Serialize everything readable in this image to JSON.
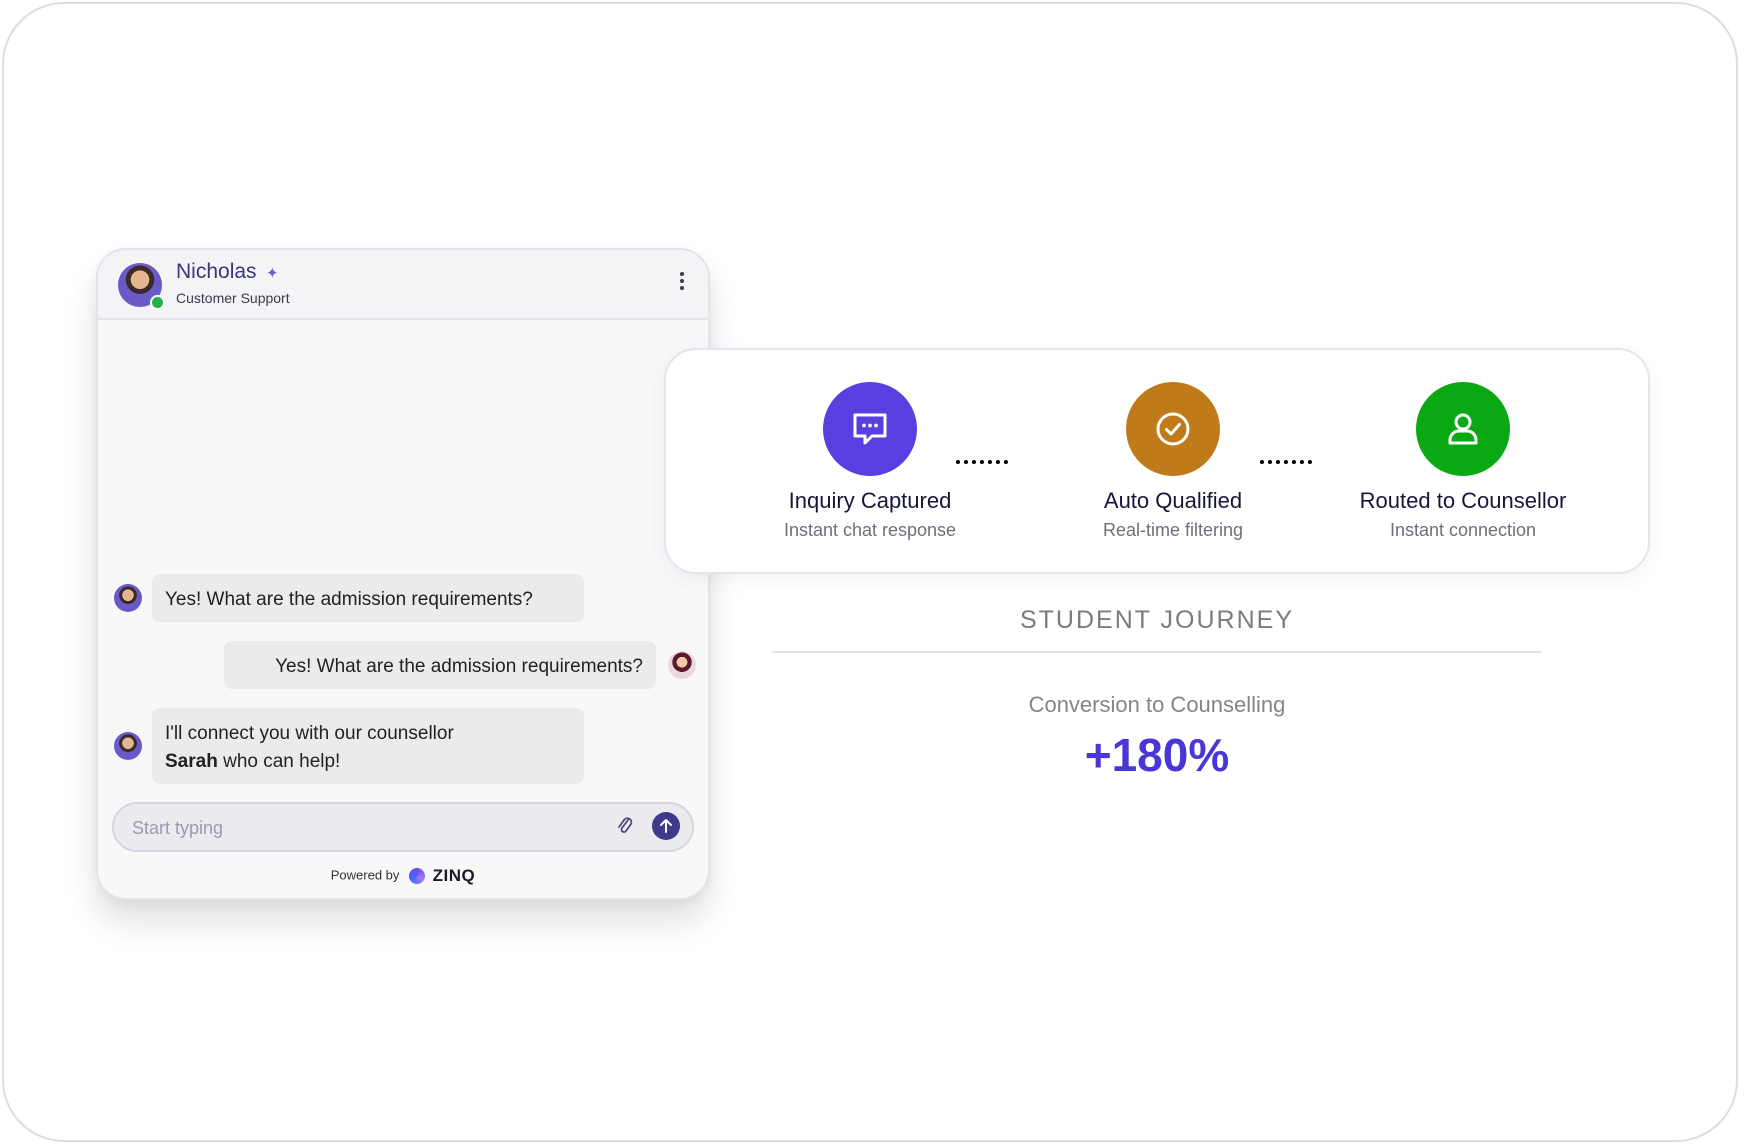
{
  "chat": {
    "agent_name": "Nicholas",
    "agent_role": "Customer Support",
    "messages": [
      {
        "from": "agent",
        "text": "Yes! What are the admission requirements?"
      },
      {
        "from": "user",
        "text": "Yes! What are the admission requirements?"
      },
      {
        "from": "agent",
        "text_before": "I'll connect you with our counsellor",
        "bold": "Sarah",
        "text_after": " who can help!"
      }
    ],
    "composer_placeholder": "Start typing",
    "powered_by": "Powered by",
    "brand": "ZINQ"
  },
  "journey": {
    "steps": [
      {
        "title": "Inquiry Captured",
        "subtitle": "Instant chat response",
        "icon": "chat-bubble-icon",
        "color": "#5a3fe0"
      },
      {
        "title": "Auto Qualified",
        "subtitle": "Real-time filtering",
        "icon": "check-circle-icon",
        "color": "#bf7a1a"
      },
      {
        "title": "Routed to Counsellor",
        "subtitle": "Instant connection",
        "icon": "user-icon",
        "color": "#0aa812"
      }
    ],
    "heading": "STUDENT JOURNEY",
    "metric_label": "Conversion to Counselling",
    "metric_value": "+180%"
  }
}
